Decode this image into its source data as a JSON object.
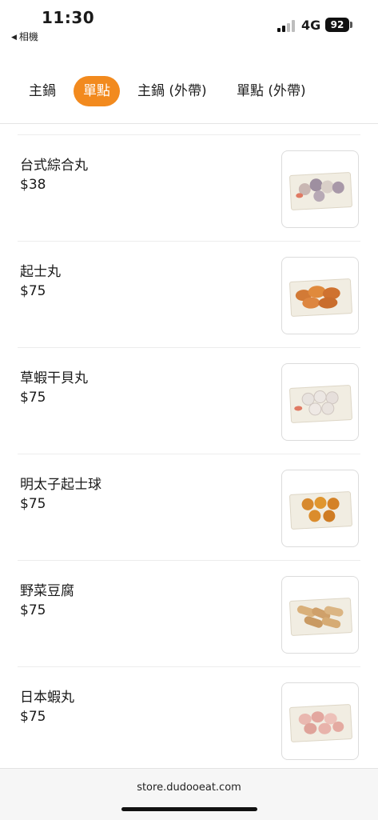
{
  "status_bar": {
    "time": "11:30",
    "back_label": "相機",
    "network": "4G",
    "battery": "92"
  },
  "tabs": [
    {
      "label": "主鍋",
      "active": false
    },
    {
      "label": "單點",
      "active": true
    },
    {
      "label": "主鍋 (外帶)",
      "active": false
    },
    {
      "label": "單點 (外帶)",
      "active": false
    }
  ],
  "colors": {
    "accent": "#f28a1e"
  },
  "items": [
    {
      "name": "台式綜合丸",
      "price": "$38"
    },
    {
      "name": "起士丸",
      "price": "$75"
    },
    {
      "name": "草蝦干貝丸",
      "price": "$75"
    },
    {
      "name": "明太子起士球",
      "price": "$75"
    },
    {
      "name": "野菜豆腐",
      "price": "$75"
    },
    {
      "name": "日本蝦丸",
      "price": "$75"
    }
  ],
  "url_bar": {
    "url": "store.dudooeat.com"
  }
}
